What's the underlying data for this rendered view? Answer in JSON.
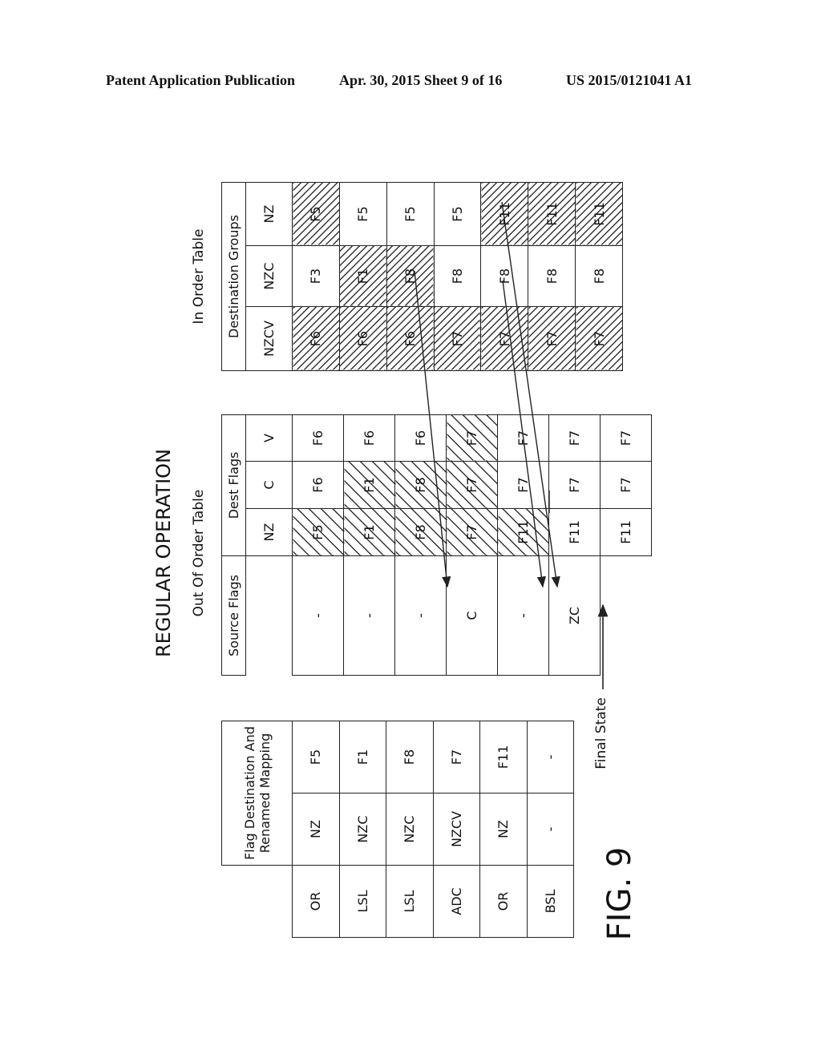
{
  "page_header": {
    "left": "Patent Application Publication",
    "middle": "Apr. 30, 2015  Sheet 9 of 16",
    "right": "US 2015/0121041 A1"
  },
  "figure": {
    "title": "REGULAR OPERATION",
    "label": "FIG. 9",
    "final_state_label": "Final State",
    "in_order_table": {
      "title": "In Order Table",
      "group_header": "Destination Groups",
      "columns": [
        "NZCV",
        "NZC",
        "NZ"
      ],
      "rows": [
        [
          "F6",
          "F3",
          "F5"
        ],
        [
          "F6",
          "F1",
          "F5"
        ],
        [
          "F6",
          "F8",
          "F5"
        ],
        [
          "F7",
          "F8",
          "F5"
        ],
        [
          "F7",
          "F8",
          "F11"
        ],
        [
          "F7",
          "F8",
          "F11"
        ],
        [
          "F7",
          "F8",
          "F11"
        ]
      ],
      "hatched": [
        [
          true,
          false,
          true
        ],
        [
          true,
          true,
          false
        ],
        [
          true,
          true,
          false
        ],
        [
          true,
          false,
          false
        ],
        [
          true,
          false,
          true
        ],
        [
          true,
          false,
          true
        ],
        [
          true,
          false,
          true
        ]
      ]
    },
    "out_of_order_table": {
      "title": "Out Of Order Table",
      "source_header": "Source Flags",
      "dest_header": "Dest Flags",
      "dest_columns": [
        "NZ",
        "C",
        "V"
      ],
      "rows": [
        {
          "source": "-",
          "dest": [
            "F5",
            "F6",
            "F6"
          ]
        },
        {
          "source": "-",
          "dest": [
            "F1",
            "F1",
            "F6"
          ]
        },
        {
          "source": "-",
          "dest": [
            "F8",
            "F8",
            "F6"
          ]
        },
        {
          "source": "C",
          "dest": [
            "F7",
            "F7",
            "F7"
          ]
        },
        {
          "source": "-",
          "dest": [
            "F11",
            "F7",
            "F7"
          ]
        },
        {
          "source": "ZC",
          "dest": [
            "F11",
            "F7",
            "F7"
          ]
        },
        {
          "source": null,
          "dest": [
            "F11",
            "F7",
            "F7"
          ]
        }
      ],
      "hatched": [
        [
          true,
          false,
          false
        ],
        [
          true,
          true,
          false
        ],
        [
          true,
          true,
          false
        ],
        [
          true,
          true,
          true
        ],
        [
          true,
          false,
          false
        ],
        [
          false,
          false,
          false
        ],
        [
          false,
          false,
          false
        ]
      ]
    },
    "mapping_table": {
      "header": "Flag Destination And Renamed Mapping",
      "rows": [
        {
          "instruction": "OR",
          "flags": "NZ",
          "renamed": "F5"
        },
        {
          "instruction": "LSL",
          "flags": "NZC",
          "renamed": "F1"
        },
        {
          "instruction": "LSL",
          "flags": "NZC",
          "renamed": "F8"
        },
        {
          "instruction": "ADC",
          "flags": "NZCV",
          "renamed": "F7"
        },
        {
          "instruction": "OR",
          "flags": "NZ",
          "renamed": "F11"
        },
        {
          "instruction": "BSL",
          "flags": "-",
          "renamed": "-"
        }
      ]
    }
  }
}
